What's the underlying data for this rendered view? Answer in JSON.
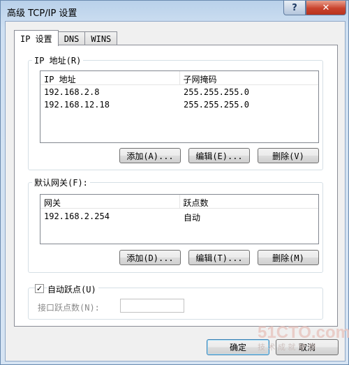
{
  "window": {
    "title": "高级 TCP/IP 设置",
    "help": "?",
    "close": "✕"
  },
  "tabs": [
    {
      "label": "IP 设置"
    },
    {
      "label": "DNS"
    },
    {
      "label": "WINS"
    }
  ],
  "ip_group": {
    "label": "IP 地址(R)",
    "columns": [
      "IP 地址",
      "子网掩码"
    ],
    "rows": [
      [
        "192.168.2.8",
        "255.255.255.0"
      ],
      [
        "192.168.12.18",
        "255.255.255.0"
      ]
    ],
    "add": "添加(A)...",
    "edit": "编辑(E)...",
    "delete": "删除(V)"
  },
  "gw_group": {
    "label": "默认网关(F):",
    "columns": [
      "网关",
      "跃点数"
    ],
    "rows": [
      [
        "192.168.2.254",
        "自动"
      ]
    ],
    "add": "添加(D)...",
    "edit": "编辑(T)...",
    "delete": "删除(M)"
  },
  "metric": {
    "auto_label": "自动跃点(U)",
    "auto_checked": true,
    "interface_label": "接口跃点数(N):",
    "interface_value": ""
  },
  "footer": {
    "ok": "确定",
    "cancel": "取消"
  },
  "watermark": {
    "logo": "51CTO.com",
    "slogan": "技 术 成 就 梦 想"
  }
}
